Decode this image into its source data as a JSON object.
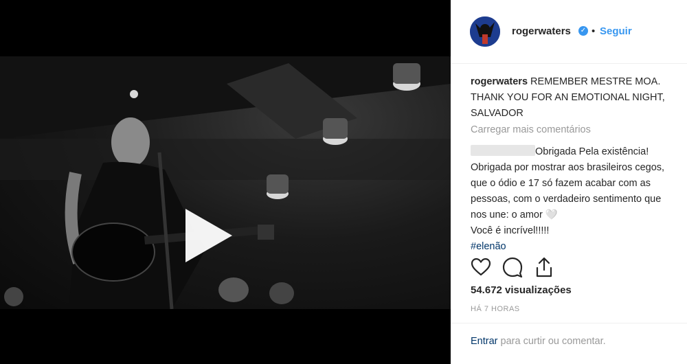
{
  "post": {
    "username": "rogerwaters",
    "separator": "•",
    "follow_label": "Seguir",
    "caption_user": "rogerwaters",
    "caption_text": "REMEMBER MESTRE MOA. THANK YOU FOR AN EMOTIONAL NIGHT, SALVADOR",
    "load_more": "Carregar mais comentários",
    "comment": {
      "line1": "Obrigada Pela existência!",
      "line2": "Obrigada por mostrar aos brasileiros cegos,",
      "line3": "que o ódio e 17 só fazem acabar com as",
      "line4": "pessoas, com o verdadeiro sentimento que",
      "line5": "nos une: o amor 🤍",
      "line6": "Você é incrível!!!!!",
      "hashtag": "#elenão"
    },
    "views": "54.672 visualizações",
    "time": "HÁ 7 HORAS",
    "login_link": "Entrar",
    "login_text": " para curtir ou comentar."
  },
  "icons": {
    "verified": "verified-badge-icon",
    "like": "heart-icon",
    "comment": "comment-icon",
    "share": "share-icon",
    "play": "play-icon"
  },
  "colors": {
    "link_blue": "#3897f0",
    "hashtag": "#003569",
    "muted": "#999999",
    "text": "#262626"
  }
}
